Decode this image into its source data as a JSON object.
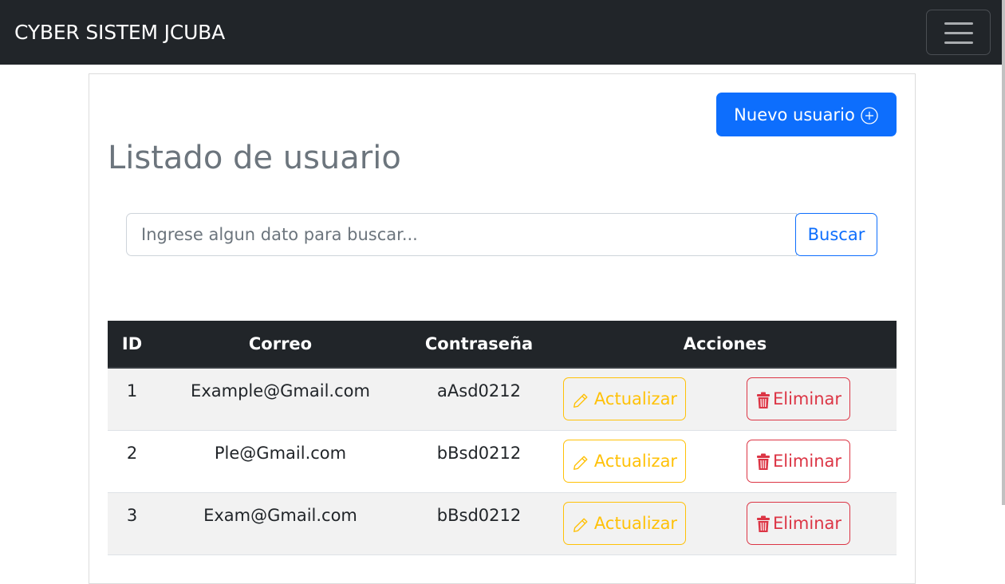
{
  "navbar": {
    "brand": "CYBER SISTEM JCUBA",
    "toggler_icon": "hamburger-menu-icon"
  },
  "header": {
    "new_user_label": "Nuevo usuario",
    "new_user_icon": "plus-circle-icon",
    "title": "Listado de usuario"
  },
  "search": {
    "placeholder": "Ingrese algun dato para buscar...",
    "value": "",
    "button_label": "Buscar"
  },
  "table": {
    "columns": [
      "ID",
      "Correo",
      "Contraseña",
      "Acciones"
    ],
    "rows": [
      {
        "id": "1",
        "correo": "Example@Gmail.com",
        "contrasena": "aAsd0212"
      },
      {
        "id": "2",
        "correo": "Ple@Gmail.com",
        "contrasena": "bBsd0212"
      },
      {
        "id": "3",
        "correo": "Exam@Gmail.com",
        "contrasena": "bBsd0212"
      }
    ],
    "update_label": "Actualizar",
    "update_icon": "pencil-icon",
    "delete_label": "Eliminar",
    "delete_icon": "trash-icon"
  },
  "colors": {
    "navbar_bg": "#212529",
    "primary": "#0d6efd",
    "warning": "#ffc107",
    "danger": "#dc3545",
    "title": "#6c757d"
  }
}
